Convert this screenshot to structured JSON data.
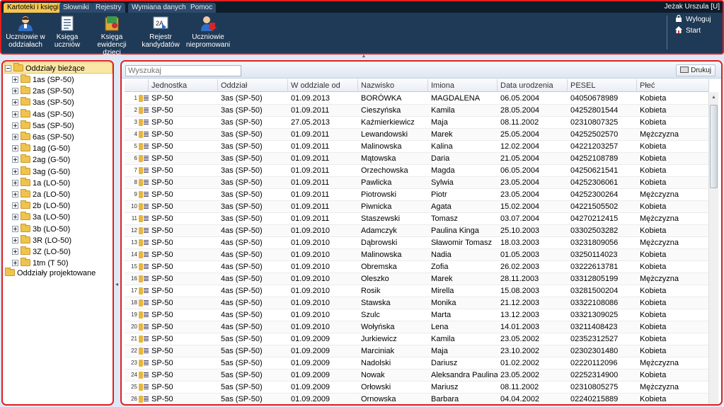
{
  "tabs": [
    {
      "label": "Kartoteki i księgi",
      "active": true
    },
    {
      "label": "Słowniki",
      "active": false
    },
    {
      "label": "Rejestry",
      "active": false
    },
    {
      "label": "Wymiana danych",
      "active": false
    },
    {
      "label": "Pomoc",
      "active": false
    }
  ],
  "user": {
    "name": "Jeżak Urszula [U]"
  },
  "ribbon": [
    {
      "label": "Uczniowie w\noddziałach",
      "icon": "students-in-classes-icon"
    },
    {
      "label": "Księga\nuczniów",
      "icon": "student-book-icon"
    },
    {
      "label": "Księga\newidencji dzieci",
      "icon": "children-register-book-icon"
    },
    {
      "label": "Rejestr\nkandydatów",
      "icon": "candidates-register-icon"
    },
    {
      "label": "Uczniowie\nniepromowani",
      "icon": "non-promoted-students-icon"
    }
  ],
  "side_links": {
    "logout": "Wyloguj",
    "start": "Start"
  },
  "tree": {
    "root": "Oddziały bieżące",
    "children": [
      "1as (SP-50)",
      "2as (SP-50)",
      "3as (SP-50)",
      "4as (SP-50)",
      "5as (SP-50)",
      "6as (SP-50)",
      "1ag (G-50)",
      "2ag (G-50)",
      "3ag (G-50)",
      "1a (LO-50)",
      "2a (LO-50)",
      "2b (LO-50)",
      "3a (LO-50)",
      "3b (LO-50)",
      "3R (LO-50)",
      "3Z (LO-50)",
      "1tm (T 50)"
    ],
    "projected": "Oddziały projektowane"
  },
  "search": {
    "placeholder": "Wyszukaj"
  },
  "print_label": "Drukuj",
  "columns": [
    "Jednostka",
    "Oddział",
    "W oddziale od",
    "Nazwisko",
    "Imiona",
    "Data urodzenia",
    "PESEL",
    "Płeć"
  ],
  "rows": [
    [
      "1",
      "SP-50",
      "3as (SP-50)",
      "01.09.2013",
      "BORÓWKA",
      "MAGDALENA",
      "06.05.2004",
      "04050678989",
      "Kobieta"
    ],
    [
      "2",
      "SP-50",
      "3as (SP-50)",
      "01.09.2011",
      "Cieszyńska",
      "Kamila",
      "28.05.2004",
      "04252801544",
      "Kobieta"
    ],
    [
      "3",
      "SP-50",
      "3as (SP-50)",
      "27.05.2013",
      "Kaźmierkiewicz",
      "Maja",
      "08.11.2002",
      "02310807325",
      "Kobieta"
    ],
    [
      "4",
      "SP-50",
      "3as (SP-50)",
      "01.09.2011",
      "Lewandowski",
      "Marek",
      "25.05.2004",
      "04252502570",
      "Mężczyzna"
    ],
    [
      "5",
      "SP-50",
      "3as (SP-50)",
      "01.09.2011",
      "Malinowska",
      "Kalina",
      "12.02.2004",
      "04221203257",
      "Kobieta"
    ],
    [
      "6",
      "SP-50",
      "3as (SP-50)",
      "01.09.2011",
      "Mątowska",
      "Daria",
      "21.05.2004",
      "04252108789",
      "Kobieta"
    ],
    [
      "7",
      "SP-50",
      "3as (SP-50)",
      "01.09.2011",
      "Orzechowska",
      "Magda",
      "06.05.2004",
      "04250621541",
      "Kobieta"
    ],
    [
      "8",
      "SP-50",
      "3as (SP-50)",
      "01.09.2011",
      "Pawlicka",
      "Sylwia",
      "23.05.2004",
      "04252306061",
      "Kobieta"
    ],
    [
      "9",
      "SP-50",
      "3as (SP-50)",
      "01.09.2011",
      "Piotrowski",
      "Piotr",
      "23.05.2004",
      "04252300264",
      "Mężczyzna"
    ],
    [
      "10",
      "SP-50",
      "3as (SP-50)",
      "01.09.2011",
      "Piwnicka",
      "Agata",
      "15.02.2004",
      "04221505502",
      "Kobieta"
    ],
    [
      "11",
      "SP-50",
      "3as (SP-50)",
      "01.09.2011",
      "Staszewski",
      "Tomasz",
      "03.07.2004",
      "04270212415",
      "Mężczyzna"
    ],
    [
      "12",
      "SP-50",
      "4as (SP-50)",
      "01.09.2010",
      "Adamczyk",
      "Paulina Kinga",
      "25.10.2003",
      "03302503282",
      "Kobieta"
    ],
    [
      "13",
      "SP-50",
      "4as (SP-50)",
      "01.09.2010",
      "Dąbrowski",
      "Sławomir Tomasz",
      "18.03.2003",
      "03231809056",
      "Mężczyzna"
    ],
    [
      "14",
      "SP-50",
      "4as (SP-50)",
      "01.09.2010",
      "Malinowska",
      "Nadia",
      "01.05.2003",
      "03250114023",
      "Kobieta"
    ],
    [
      "15",
      "SP-50",
      "4as (SP-50)",
      "01.09.2010",
      "Obremska",
      "Zofia",
      "26.02.2003",
      "03222613781",
      "Kobieta"
    ],
    [
      "16",
      "SP-50",
      "4as (SP-50)",
      "01.09.2010",
      "Oleszko",
      "Marek",
      "28.11.2003",
      "03312805199",
      "Mężczyzna"
    ],
    [
      "17",
      "SP-50",
      "4as (SP-50)",
      "01.09.2010",
      "Rosik",
      "Mirella",
      "15.08.2003",
      "03281500204",
      "Kobieta"
    ],
    [
      "18",
      "SP-50",
      "4as (SP-50)",
      "01.09.2010",
      "Stawska",
      "Monika",
      "21.12.2003",
      "03322108086",
      "Kobieta"
    ],
    [
      "19",
      "SP-50",
      "4as (SP-50)",
      "01.09.2010",
      "Szulc",
      "Marta",
      "13.12.2003",
      "03321309025",
      "Kobieta"
    ],
    [
      "20",
      "SP-50",
      "4as (SP-50)",
      "01.09.2010",
      "Wołyńska",
      "Lena",
      "14.01.2003",
      "03211408423",
      "Kobieta"
    ],
    [
      "21",
      "SP-50",
      "5as (SP-50)",
      "01.09.2009",
      "Jurkiewicz",
      "Kamila",
      "23.05.2002",
      "02352312527",
      "Kobieta"
    ],
    [
      "22",
      "SP-50",
      "5as (SP-50)",
      "01.09.2009",
      "Marciniak",
      "Maja",
      "23.10.2002",
      "02302301480",
      "Kobieta"
    ],
    [
      "23",
      "SP-50",
      "5as (SP-50)",
      "01.09.2009",
      "Nadolski",
      "Dariusz",
      "01.02.2002",
      "02220112096",
      "Mężczyzna"
    ],
    [
      "24",
      "SP-50",
      "5as (SP-50)",
      "01.09.2009",
      "Nowak",
      "Aleksandra Paulina",
      "23.05.2002",
      "02252314900",
      "Kobieta"
    ],
    [
      "25",
      "SP-50",
      "5as (SP-50)",
      "01.09.2009",
      "Orłowski",
      "Mariusz",
      "08.11.2002",
      "02310805275",
      "Mężczyzna"
    ],
    [
      "26",
      "SP-50",
      "5as (SP-50)",
      "01.09.2009",
      "Ornowska",
      "Barbara",
      "04.04.2002",
      "02240215889",
      "Kobieta"
    ]
  ],
  "colors": {
    "accent_tab": "#f5c650",
    "ribbon_bg": "#1f3a57",
    "highlight_border": "#e02020"
  }
}
